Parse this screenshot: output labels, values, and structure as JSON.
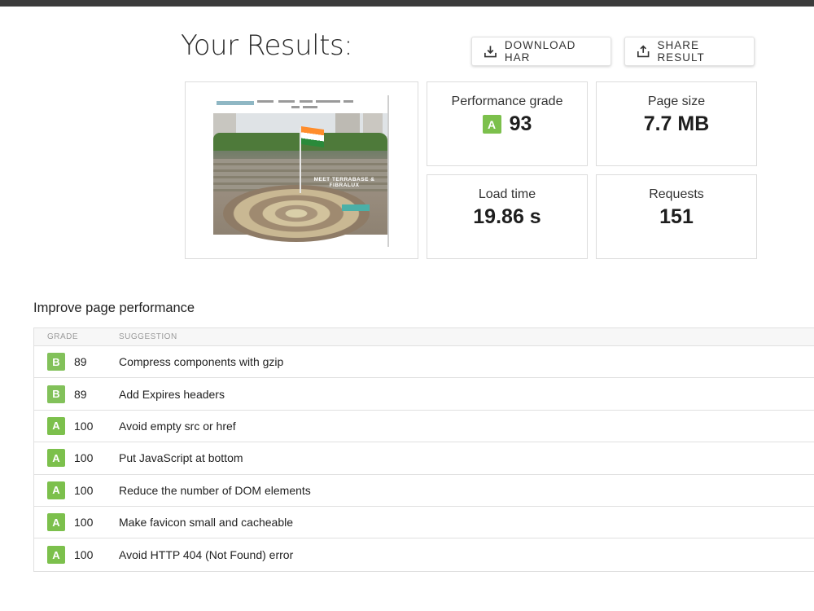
{
  "header": {
    "title": "Your Results:",
    "download_label": "DOWNLOAD HAR",
    "share_label": "SHARE RESULT"
  },
  "screenshot": {
    "headline": "MEET TERRABASE & FIBRALUX"
  },
  "metrics": {
    "performance": {
      "label": "Performance grade",
      "grade": "A",
      "value": "93"
    },
    "page_size": {
      "label": "Page size",
      "value": "7.7 MB"
    },
    "load_time": {
      "label": "Load time",
      "value": "19.86 s"
    },
    "requests": {
      "label": "Requests",
      "value": "151"
    }
  },
  "improve": {
    "title": "Improve page performance",
    "columns": {
      "grade": "GRADE",
      "suggestion": "SUGGESTION"
    },
    "rows": [
      {
        "grade": "B",
        "score": "89",
        "suggestion": "Compress components with gzip"
      },
      {
        "grade": "B",
        "score": "89",
        "suggestion": "Add Expires headers"
      },
      {
        "grade": "A",
        "score": "100",
        "suggestion": "Avoid empty src or href"
      },
      {
        "grade": "A",
        "score": "100",
        "suggestion": "Put JavaScript at bottom"
      },
      {
        "grade": "A",
        "score": "100",
        "suggestion": "Reduce the number of DOM elements"
      },
      {
        "grade": "A",
        "score": "100",
        "suggestion": "Make favicon small and cacheable"
      },
      {
        "grade": "A",
        "score": "100",
        "suggestion": "Avoid HTTP 404 (Not Found) error"
      }
    ]
  },
  "colors": {
    "grade_green": "#7cc04c",
    "topbar": "#3b3b3b"
  }
}
